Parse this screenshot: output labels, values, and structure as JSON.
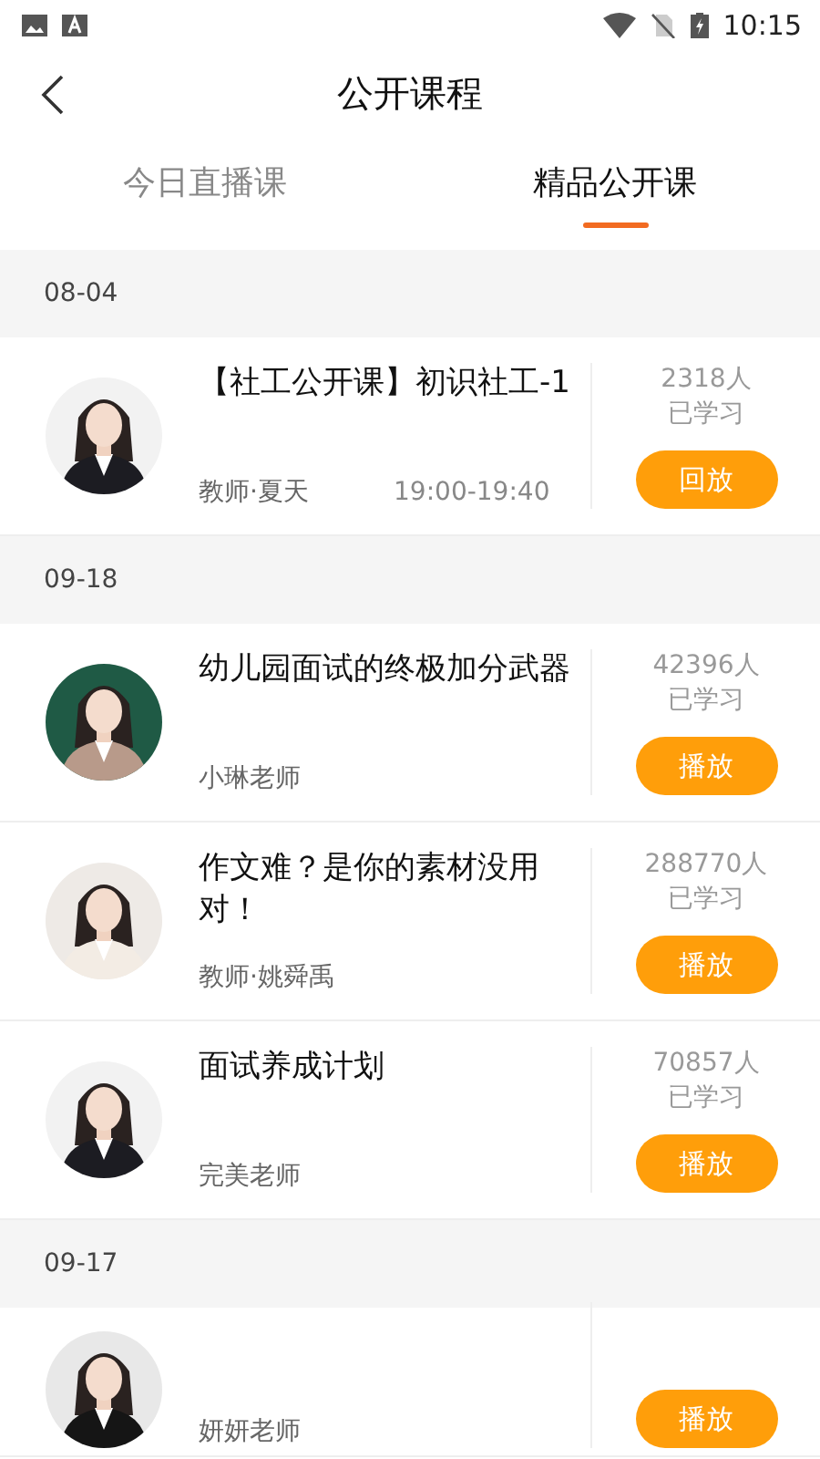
{
  "status_bar": {
    "time": "10:15"
  },
  "header": {
    "title": "公开课程"
  },
  "tabs": [
    {
      "label": "今日直播课",
      "selected": false
    },
    {
      "label": "精品公开课",
      "selected": true
    }
  ],
  "sections": [
    {
      "date": "08-04",
      "courses": [
        {
          "title": "【社工公开课】初识社工-1",
          "teacher": "教师·夏天",
          "time": "19:00-19:40",
          "learners": "2318人",
          "learned_label": "已学习",
          "action": "回放"
        }
      ]
    },
    {
      "date": "09-18",
      "courses": [
        {
          "title": "幼儿园面试的终极加分武器",
          "teacher": "小琳老师",
          "learners": "42396人",
          "learned_label": "已学习",
          "action": "播放"
        },
        {
          "title": "作文难？是你的素材没用对！",
          "teacher": "教师·姚舜禹",
          "learners": "288770人",
          "learned_label": "已学习",
          "action": "播放"
        },
        {
          "title": "面试养成计划",
          "teacher": "完美老师",
          "learners": "70857人",
          "learned_label": "已学习",
          "action": "播放"
        }
      ]
    },
    {
      "date": "09-17",
      "courses": [
        {
          "teacher": "妍妍老师",
          "action": "播放"
        }
      ]
    }
  ]
}
